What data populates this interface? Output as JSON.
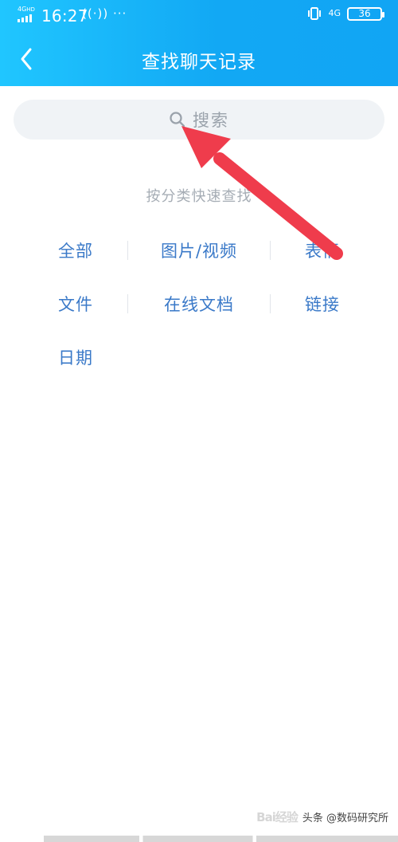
{
  "status_bar": {
    "network_left": "4G",
    "network_left_sub": "HD",
    "time": "16:27",
    "indicators": "((·)) ···",
    "network_right": "4G",
    "battery_level": "36"
  },
  "header": {
    "title": "查找聊天记录"
  },
  "search": {
    "placeholder": "搜索"
  },
  "quick_filter": {
    "heading": "按分类快速查找",
    "rows": [
      [
        "全部",
        "图片/视频",
        "表情"
      ],
      [
        "文件",
        "在线文档",
        "链接"
      ],
      [
        "日期"
      ]
    ]
  },
  "watermark": {
    "source": "头条 @数码研究所",
    "baidu": "Bai经验"
  },
  "colors": {
    "header_blue": "#16b0f8",
    "link_blue": "#3a79c8",
    "annotation_red": "#ef3c4c"
  }
}
